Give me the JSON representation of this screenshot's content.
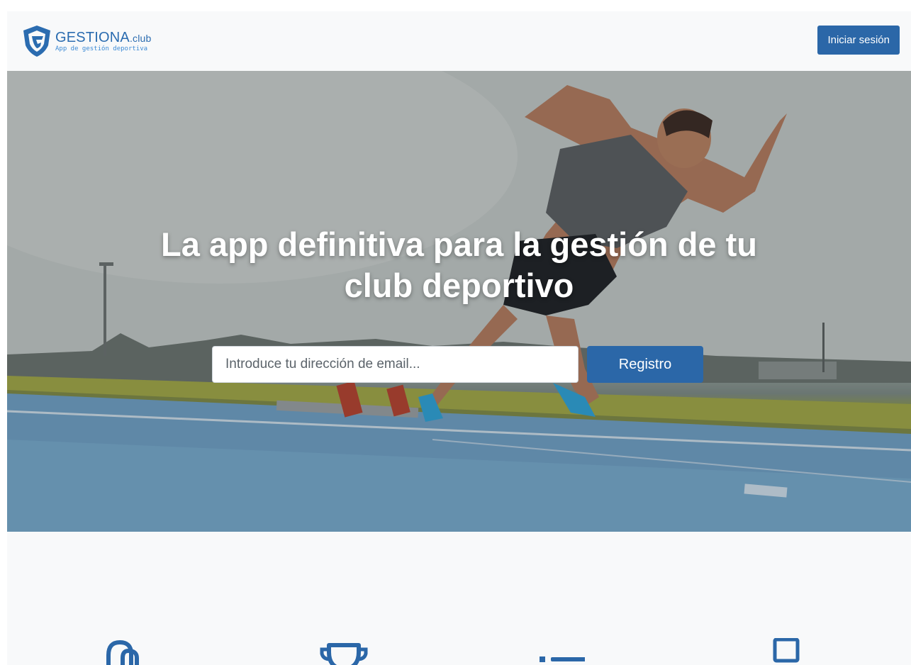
{
  "header": {
    "brand_name": "GESTIONA",
    "brand_suffix": ".club",
    "brand_tagline": "App de gestión deportiva",
    "login_label": "Iniciar sesión"
  },
  "hero": {
    "title_line1": "La app definitiva para la gestión de tu",
    "title_line2": "club deportivo",
    "email_placeholder": "Introduce tu dirección de email...",
    "register_label": "Registro"
  },
  "features": {
    "icons": [
      "mobile-icon",
      "trophy-icon",
      "list-icon",
      "laptop-icon"
    ]
  },
  "colors": {
    "primary": "#2b67a8",
    "brand_text": "#2b6cb0",
    "background": "#f8f9fa"
  }
}
